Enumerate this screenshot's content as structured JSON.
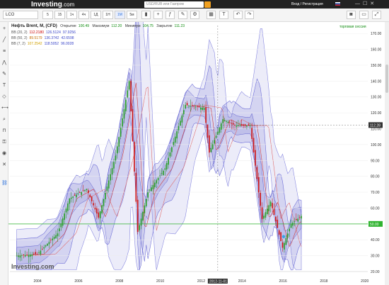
{
  "header": {
    "logo": "Investing",
    "logo_suffix": ".com",
    "search_placeholder": "USD/RUB или Газпром",
    "login_link": "Вход / Регистрация"
  },
  "toolbar": {
    "symbol": "LCO",
    "timeframes": [
      "5",
      "15",
      "1ч",
      "4ч",
      "1Д",
      "1Н",
      "1М",
      "5м"
    ],
    "active_timeframe": "1М"
  },
  "legend": {
    "title": "Нефть Brent, М, (CFD)",
    "open_label": "Открытие",
    "open_value": "100.49",
    "high_label": "Максимум",
    "high_value": "112.20",
    "low_label": "Минимум",
    "low_value": "104.75",
    "close_label": "Закрытие",
    "close_value": "111.23",
    "session_label": "торговая сессия",
    "indicators": [
      {
        "label": "BB (20, 2)",
        "values": [
          "112.2180",
          "126.5124",
          "97.9256"
        ],
        "color": "#cc0000"
      },
      {
        "label": "BB (50, 2)",
        "values": [
          "89.5179",
          "136.3742",
          "42.6598"
        ],
        "color": "#c46a00"
      },
      {
        "label": "BB (7, 2)",
        "values": [
          "107.2542",
          "118.5052",
          "96.0028"
        ],
        "color": "#d0a000"
      }
    ]
  },
  "axis": {
    "y_ticks": [
      "170.00",
      "160.00",
      "150.00",
      "140.00",
      "130.00",
      "120.00",
      "110.00",
      "100.00",
      "90.00",
      "80.00",
      "70.00",
      "60.00",
      "50.00",
      "40.00",
      "30.00",
      "20.00"
    ],
    "x_ticks": [
      "2004",
      "2006",
      "2008",
      "2010",
      "2012",
      "2014",
      "2016",
      "2018",
      "2020"
    ],
    "crosshair_date": "2012-11-01",
    "current_price": "112.28",
    "level_price": "50.00"
  },
  "watermark": "Investing.com",
  "chart_data": {
    "type": "candlestick",
    "xlim": [
      "2002-09",
      "2020-03"
    ],
    "ylim": [
      20,
      175
    ],
    "candles_approx_close": [
      {
        "x": "2003-01",
        "y": 30
      },
      {
        "x": "2004-01",
        "y": 31
      },
      {
        "x": "2005-01",
        "y": 44
      },
      {
        "x": "2005-08",
        "y": 66
      },
      {
        "x": "2006-06",
        "y": 72
      },
      {
        "x": "2007-01",
        "y": 54
      },
      {
        "x": "2007-11",
        "y": 93
      },
      {
        "x": "2008-07",
        "y": 140
      },
      {
        "x": "2008-12",
        "y": 45
      },
      {
        "x": "2009-06",
        "y": 70
      },
      {
        "x": "2010-04",
        "y": 85
      },
      {
        "x": "2011-04",
        "y": 125
      },
      {
        "x": "2012-03",
        "y": 123
      },
      {
        "x": "2012-06",
        "y": 95
      },
      {
        "x": "2013-02",
        "y": 116
      },
      {
        "x": "2013-09",
        "y": 112
      },
      {
        "x": "2014-06",
        "y": 112
      },
      {
        "x": "2015-01",
        "y": 53
      },
      {
        "x": "2015-06",
        "y": 64
      },
      {
        "x": "2016-01",
        "y": 35
      },
      {
        "x": "2016-06",
        "y": 50
      },
      {
        "x": "2016-12",
        "y": 55
      }
    ]
  }
}
